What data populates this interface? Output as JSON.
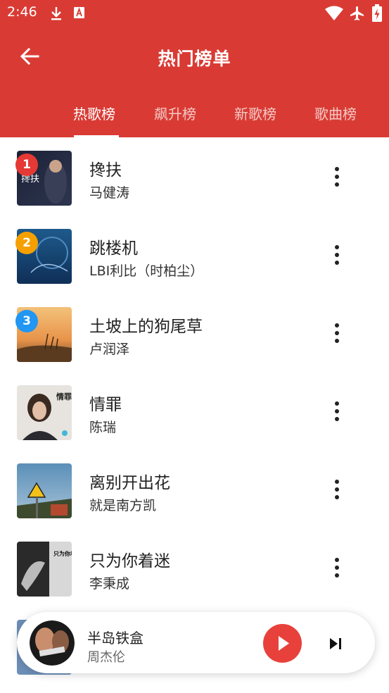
{
  "status_bar": {
    "time": "2:46"
  },
  "app_bar": {
    "title": "热门榜单"
  },
  "tabs": [
    {
      "label": "热歌榜",
      "active": true
    },
    {
      "label": "飙升榜",
      "active": false
    },
    {
      "label": "新歌榜",
      "active": false
    },
    {
      "label": "歌曲榜",
      "active": false
    }
  ],
  "songs": [
    {
      "rank": "1",
      "title": "搀扶",
      "artist": "马健涛",
      "rank_color": "#e53935",
      "cover_text": "搀扶"
    },
    {
      "rank": "2",
      "title": "跳楼机",
      "artist": "LBI利比（时柏尘）",
      "rank_color": "#f5a000",
      "cover_text": ""
    },
    {
      "rank": "3",
      "title": "土坡上的狗尾草",
      "artist": "卢润泽",
      "rank_color": "#2196f3",
      "cover_text": ""
    },
    {
      "title": "情罪",
      "artist": "陈瑞",
      "cover_text": "情罪"
    },
    {
      "title": "离别开出花",
      "artist": "就是南方凯",
      "cover_text": ""
    },
    {
      "title": "只为你着迷",
      "artist": "李秉成",
      "cover_text": "只为你着迷"
    }
  ],
  "now_playing": {
    "title": "半岛铁盒",
    "artist": "周杰伦"
  },
  "colors": {
    "primary": "#d93b34",
    "play_button": "#e8413c"
  }
}
